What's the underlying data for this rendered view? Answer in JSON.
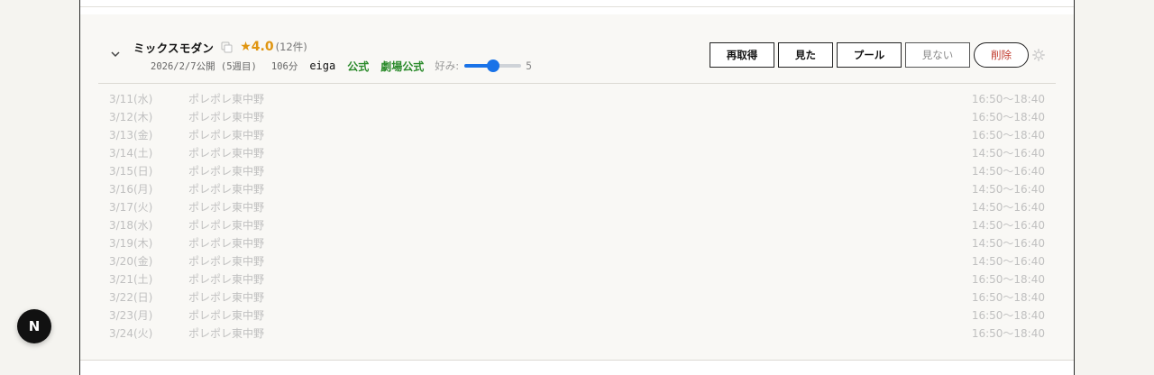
{
  "movie": {
    "title": "ミックスモダン",
    "rating": "★4.0",
    "rating_count": "(12件)",
    "release": "2026/2/7公開 (5週目)",
    "runtime": "106分",
    "source": "eiga",
    "official_link": "公式",
    "theater_official_link": "劇場公式",
    "preference_label": "好み:",
    "preference_value": "5",
    "preference_fraction": 0.5
  },
  "actions": {
    "refetch": "再取得",
    "watched": "見た",
    "pool": "プール",
    "not_watching": "見ない",
    "delete": "削除"
  },
  "showings": [
    {
      "date": "3/11(水)",
      "venue": "ポレポレ東中野",
      "time": "16:50〜18:40"
    },
    {
      "date": "3/12(木)",
      "venue": "ポレポレ東中野",
      "time": "16:50〜18:40"
    },
    {
      "date": "3/13(金)",
      "venue": "ポレポレ東中野",
      "time": "16:50〜18:40"
    },
    {
      "date": "3/14(土)",
      "venue": "ポレポレ東中野",
      "time": "14:50〜16:40"
    },
    {
      "date": "3/15(日)",
      "venue": "ポレポレ東中野",
      "time": "14:50〜16:40"
    },
    {
      "date": "3/16(月)",
      "venue": "ポレポレ東中野",
      "time": "14:50〜16:40"
    },
    {
      "date": "3/17(火)",
      "venue": "ポレポレ東中野",
      "time": "14:50〜16:40"
    },
    {
      "date": "3/18(水)",
      "venue": "ポレポレ東中野",
      "time": "14:50〜16:40"
    },
    {
      "date": "3/19(木)",
      "venue": "ポレポレ東中野",
      "time": "14:50〜16:40"
    },
    {
      "date": "3/20(金)",
      "venue": "ポレポレ東中野",
      "time": "14:50〜16:40"
    },
    {
      "date": "3/21(土)",
      "venue": "ポレポレ東中野",
      "time": "16:50〜18:40"
    },
    {
      "date": "3/22(日)",
      "venue": "ポレポレ東中野",
      "time": "16:50〜18:40"
    },
    {
      "date": "3/23(月)",
      "venue": "ポレポレ東中野",
      "time": "16:50〜18:40"
    },
    {
      "date": "3/24(火)",
      "venue": "ポレポレ東中野",
      "time": "16:50〜18:40"
    }
  ],
  "fab_label": "N",
  "icons": {
    "expand": "chevron-down-icon",
    "copy": "copy-icon",
    "settings": "gear-icon"
  },
  "colors": {
    "rating": "#e09510",
    "link": "#2a8a2a",
    "danger": "#c0392b",
    "slider": "#1a73e8"
  }
}
